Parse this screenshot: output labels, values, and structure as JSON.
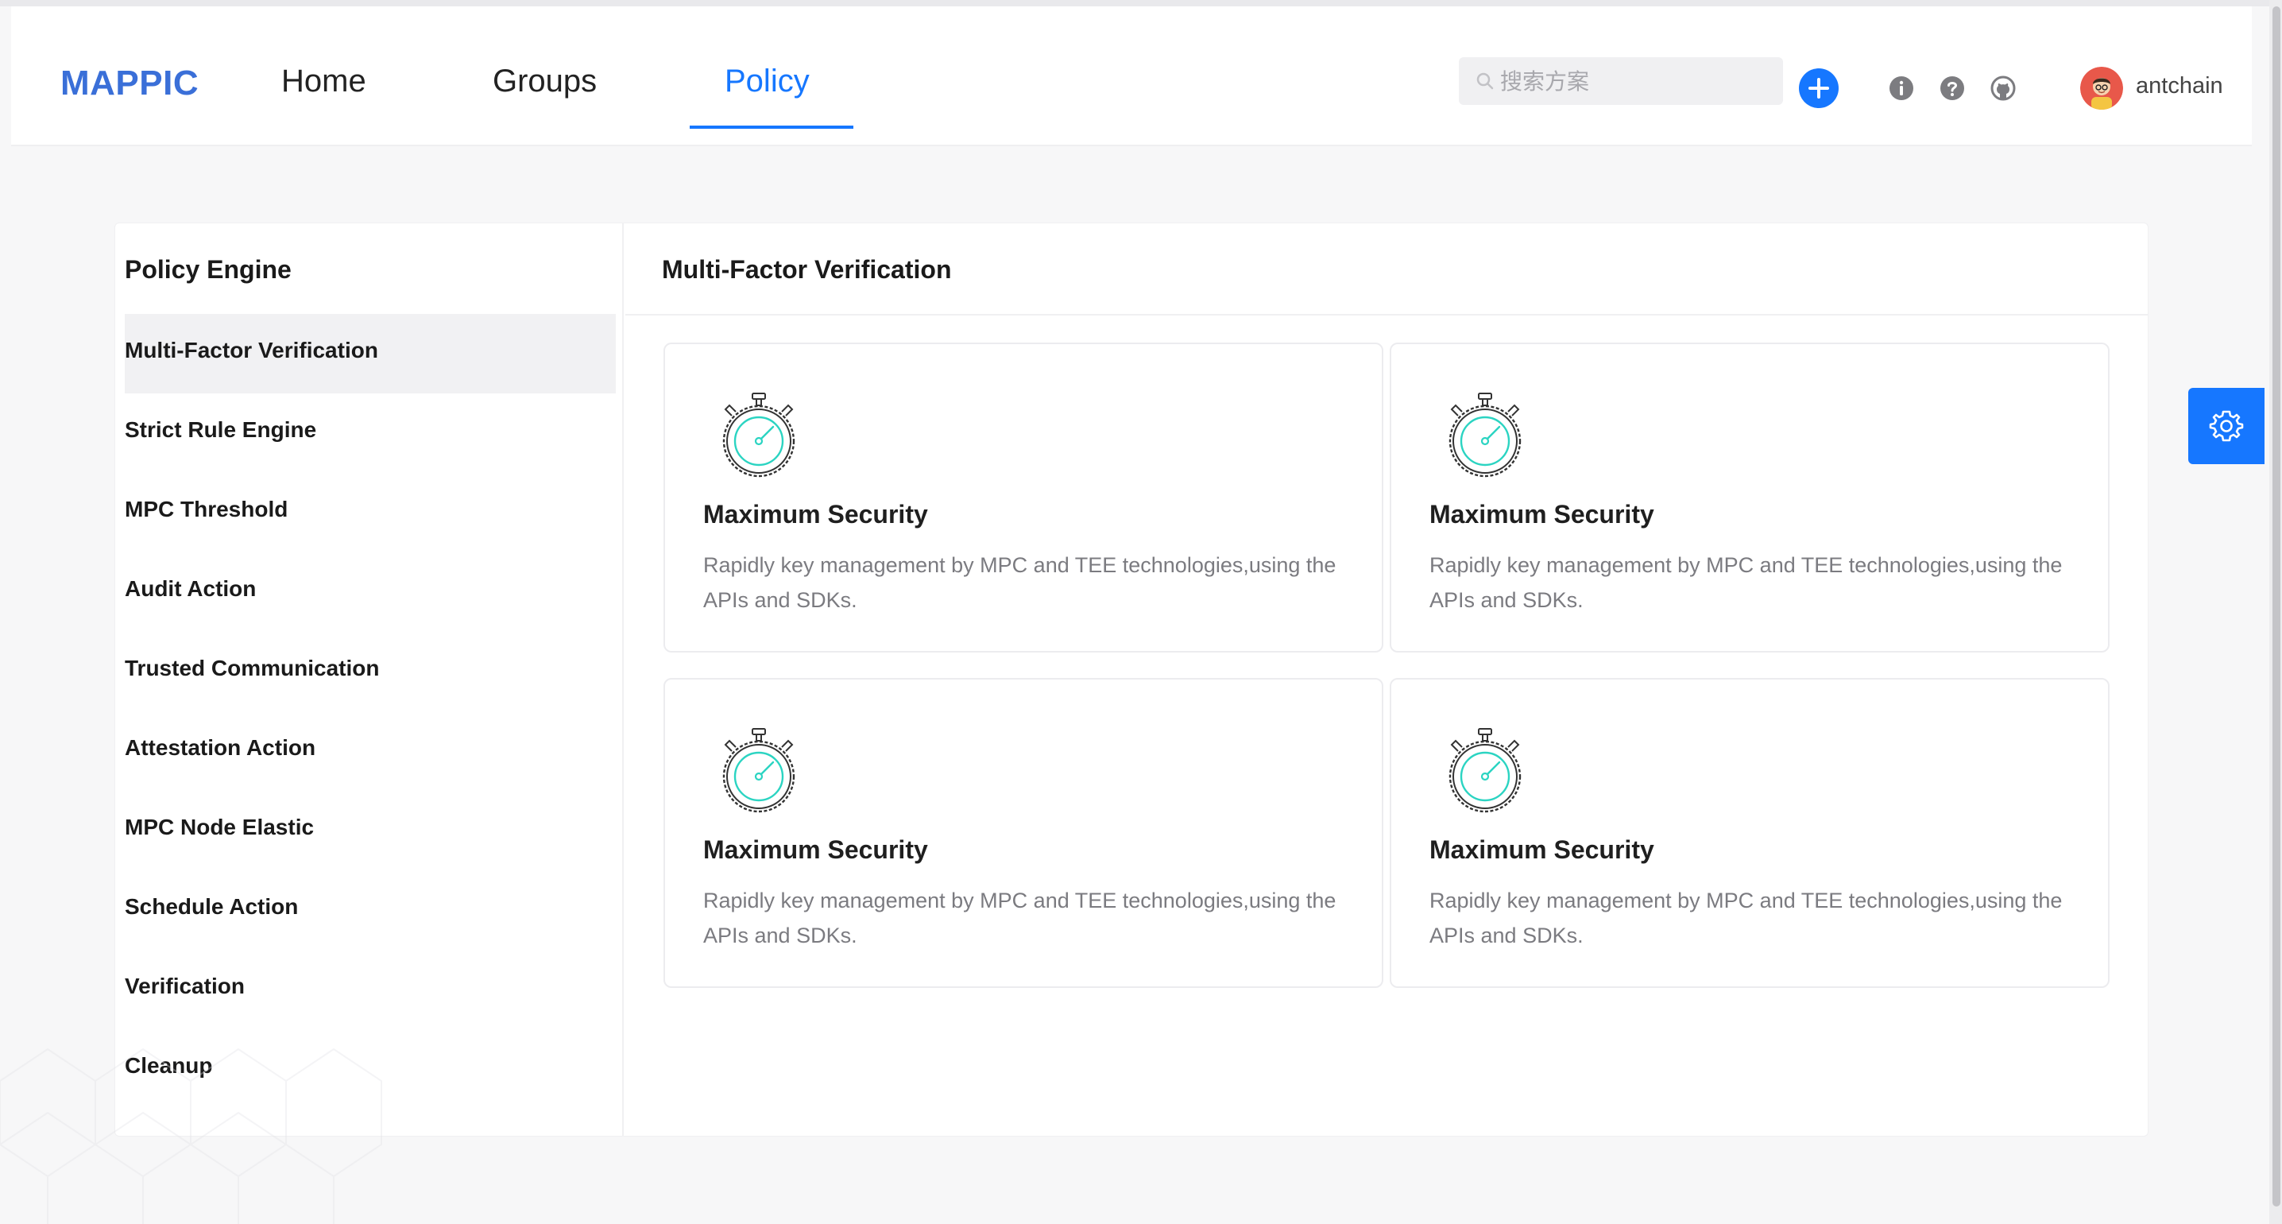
{
  "header": {
    "logo": "MAPPIC",
    "nav": [
      {
        "label": "Home"
      },
      {
        "label": "Groups"
      },
      {
        "label": "Policy"
      }
    ],
    "search_placeholder": "搜索方案",
    "username": "antchain",
    "icons": [
      "search-icon",
      "plus-icon",
      "info-icon",
      "question-icon",
      "github-icon"
    ]
  },
  "sidebar": {
    "title": "Policy Engine",
    "items": [
      {
        "label": "Multi-Factor Verification"
      },
      {
        "label": "Strict Rule Engine"
      },
      {
        "label": "MPC Threshold"
      },
      {
        "label": "Audit Action"
      },
      {
        "label": "Trusted Communication"
      },
      {
        "label": "Attestation Action"
      },
      {
        "label": "MPC Node Elastic"
      },
      {
        "label": "Schedule Action"
      },
      {
        "label": "Verification"
      },
      {
        "label": "Cleanup"
      }
    ]
  },
  "main": {
    "title": "Multi-Factor Verification",
    "cards": [
      {
        "title": "Maximum Security",
        "desc": "Rapidly key management by MPC and TEE technologies,using the APIs and SDKs.",
        "icon": "stopwatch-icon"
      },
      {
        "title": "Maximum Security",
        "desc": "Rapidly key management by MPC and TEE technologies,using the APIs and SDKs.",
        "icon": "stopwatch-icon"
      },
      {
        "title": "Maximum Security",
        "desc": "Rapidly key management by MPC and TEE technologies,using the APIs and SDKs.",
        "icon": "stopwatch-icon"
      },
      {
        "title": "Maximum Security",
        "desc": "Rapidly key management by MPC and TEE technologies,using the APIs and SDKs.",
        "icon": "stopwatch-icon"
      }
    ]
  },
  "colors": {
    "accent": "#1677ff",
    "logo": "#3a6fd8",
    "icon_teal": "#2bd4c2",
    "active_bg": "#f1f1f3"
  }
}
